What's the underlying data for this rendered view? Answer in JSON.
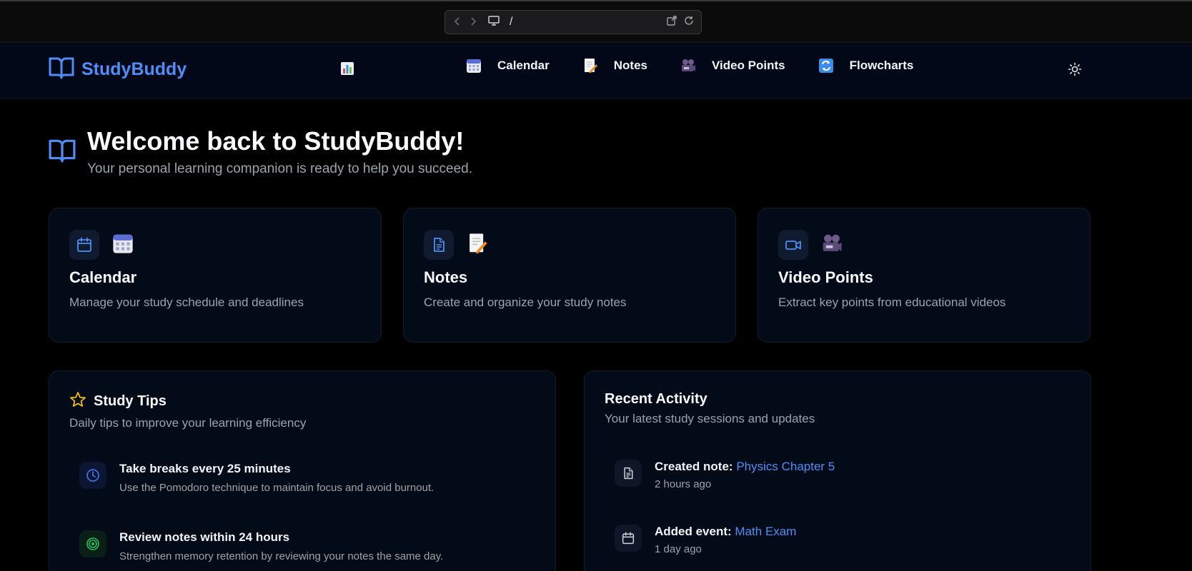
{
  "browser": {
    "url": "/",
    "back_icon": "chevron-left-icon",
    "forward_icon": "chevron-right-icon",
    "monitor_icon": "monitor-icon",
    "open_external_icon": "external-link-icon",
    "reload_icon": "reload-icon"
  },
  "header": {
    "brand": "StudyBuddy",
    "brand_icon": "open-book-icon",
    "nav": [
      {
        "label": "Calendar",
        "icon": "calendar-emoji-icon"
      },
      {
        "label": "Notes",
        "icon": "memo-emoji-icon"
      },
      {
        "label": "Video Points",
        "icon": "movie-camera-emoji-icon"
      },
      {
        "label": "Flowcharts",
        "icon": "arrows-cycle-emoji-icon"
      }
    ],
    "stats_icon": "bar-chart-emoji-icon",
    "theme_icon": "sun-icon"
  },
  "welcome": {
    "title": "Welcome back to StudyBuddy!",
    "subtitle": "Your personal learning companion is ready to help you succeed."
  },
  "features": [
    {
      "title": "Calendar",
      "desc": "Manage your study schedule and deadlines"
    },
    {
      "title": "Notes",
      "desc": "Create and organize your study notes"
    },
    {
      "title": "Video Points",
      "desc": "Extract key points from educational videos"
    }
  ],
  "tips": {
    "title": "Study Tips",
    "subtitle": "Daily tips to improve your learning efficiency",
    "items": [
      {
        "title": "Take breaks every 25 minutes",
        "desc": "Use the Pomodoro technique to maintain focus and avoid burnout."
      },
      {
        "title": "Review notes within 24 hours",
        "desc": "Strengthen memory retention by reviewing your notes the same day."
      }
    ]
  },
  "activity": {
    "title": "Recent Activity",
    "subtitle": "Your latest study sessions and updates",
    "items": [
      {
        "prefix": "Created note:",
        "link": "Physics Chapter 5",
        "time": "2 hours ago"
      },
      {
        "prefix": "Added event:",
        "link": "Math Exam",
        "time": "1 day ago"
      }
    ]
  },
  "colors": {
    "accent": "#4f8ef7",
    "background": "#000000",
    "card": "#030a18",
    "star": "#f5b81a",
    "tip_green": "#22c55e"
  }
}
